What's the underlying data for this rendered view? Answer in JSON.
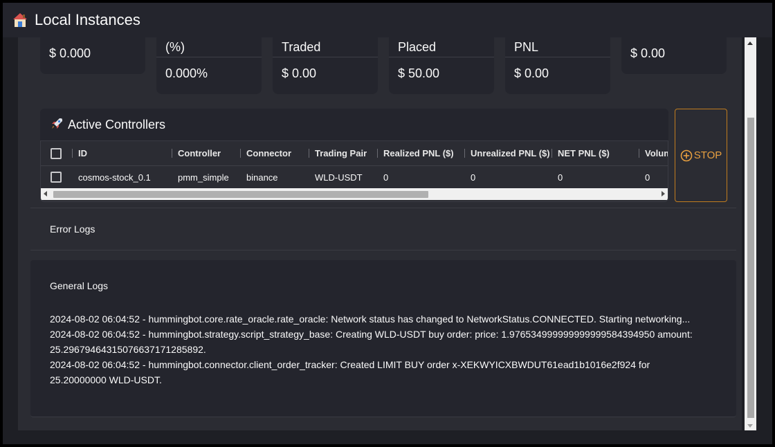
{
  "header": {
    "title": "Local Instances",
    "icon": "house-icon"
  },
  "metrics": [
    {
      "label": "",
      "value": "$ 0.000"
    },
    {
      "label": "(%)",
      "value": "0.000%"
    },
    {
      "label": "Traded",
      "value": "$ 0.00"
    },
    {
      "label": "Placed",
      "value": "$ 50.00"
    },
    {
      "label": "PNL",
      "value": "$ 0.00"
    },
    {
      "label": "",
      "value": "$ 0.00"
    }
  ],
  "controllers": {
    "title": "Active Controllers",
    "icon": "rocket-icon",
    "columns": [
      "ID",
      "Controller",
      "Connector",
      "Trading Pair",
      "Realized PNL ($)",
      "Unrealized PNL ($)",
      "NET PNL ($)",
      "Volum"
    ],
    "rows": [
      [
        "cosmos-stock_0.1",
        "pmm_simple",
        "binance",
        "WLD-USDT",
        "0",
        "0",
        "0",
        "0"
      ]
    ]
  },
  "stop_button": {
    "label": "STOP"
  },
  "logs": {
    "error_label": "Error Logs",
    "general_label": "General Logs",
    "general_lines": [
      "2024-08-02 06:04:52 - hummingbot.core.rate_oracle.rate_oracle: Network status has changed to NetworkStatus.CONNECTED. Starting networking...",
      "2024-08-02 06:04:52 - hummingbot.strategy.script_strategy_base: Creating WLD-USDT buy order: price: 1.976534999999999999584394950 amount: 25.29679464315076637171285892.",
      "2024-08-02 06:04:52 - hummingbot.connector.client_order_tracker: Created LIMIT BUY order x-XEKWYICXBWDUT61ead1b1016e2f924 for 25.20000000 WLD-USDT."
    ]
  },
  "colors": {
    "accent": "#e8a040",
    "background": "#2b2c33",
    "card": "#24252d"
  }
}
